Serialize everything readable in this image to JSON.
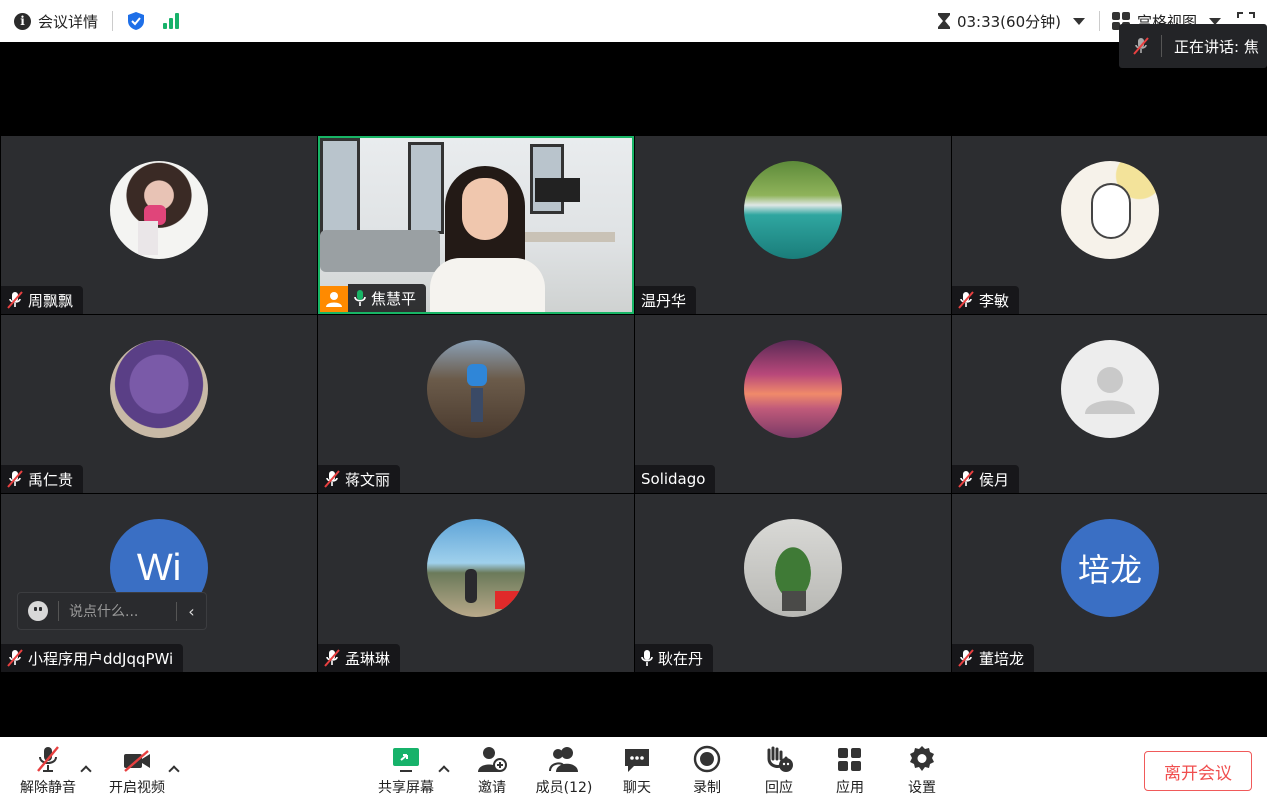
{
  "topbar": {
    "meeting_info_label": "会议详情",
    "timer": "03:33(60分钟)",
    "view_label": "宫格视图"
  },
  "speaking": {
    "label": "正在讲话:  焦"
  },
  "participants": [
    {
      "name": "周飘飘",
      "mic": "muted",
      "avatar": "photo"
    },
    {
      "name": "焦慧平",
      "mic": "on",
      "avatar": "video",
      "host": true
    },
    {
      "name": "温丹华",
      "mic": "none",
      "avatar": "photo"
    },
    {
      "name": "李敏",
      "mic": "muted",
      "avatar": "photo"
    },
    {
      "name": "禹仁贵",
      "mic": "muted",
      "avatar": "photo"
    },
    {
      "name": "蒋文丽",
      "mic": "muted",
      "avatar": "photo"
    },
    {
      "name": "Solidago",
      "mic": "none",
      "avatar": "photo"
    },
    {
      "name": "侯月",
      "mic": "muted",
      "avatar": "default"
    },
    {
      "name": "小程序用户ddJqqPWi",
      "mic": "muted",
      "avatar": "initials",
      "initials": "Wi"
    },
    {
      "name": "孟琳琳",
      "mic": "muted",
      "avatar": "photo"
    },
    {
      "name": "耿在丹",
      "mic": "on",
      "avatar": "photo"
    },
    {
      "name": "董培龙",
      "mic": "muted",
      "avatar": "initials",
      "initials": "培龙"
    }
  ],
  "chat": {
    "placeholder": "说点什么..."
  },
  "toolbar": {
    "unmute_label": "解除静音",
    "video_label": "开启视频",
    "share_label": "共享屏幕",
    "invite_label": "邀请",
    "members_label": "成员(12)",
    "chat_label": "聊天",
    "record_label": "录制",
    "react_label": "回应",
    "apps_label": "应用",
    "settings_label": "设置",
    "leave_label": "离开会议"
  },
  "colors": {
    "accent_green": "#17b26a",
    "host_orange": "#ff8a00",
    "leave_red": "#f04e4e",
    "initials_blue": "#3a6fc4",
    "tile_bg": "#2c2d30"
  }
}
